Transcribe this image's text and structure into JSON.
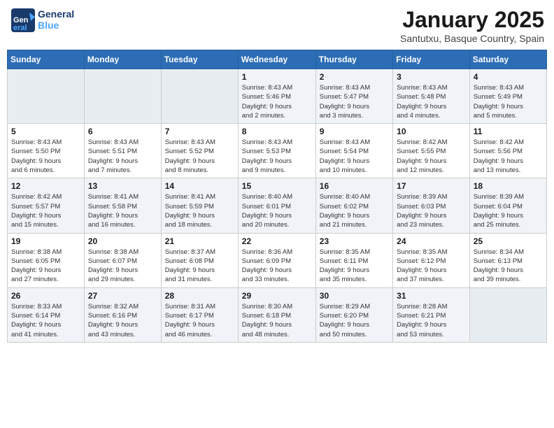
{
  "header": {
    "logo_text_general": "General",
    "logo_text_blue": "Blue",
    "month_title": "January 2025",
    "subtitle": "Santutxu, Basque Country, Spain"
  },
  "weekdays": [
    "Sunday",
    "Monday",
    "Tuesday",
    "Wednesday",
    "Thursday",
    "Friday",
    "Saturday"
  ],
  "weeks": [
    [
      {
        "day": "",
        "info": ""
      },
      {
        "day": "",
        "info": ""
      },
      {
        "day": "",
        "info": ""
      },
      {
        "day": "1",
        "info": "Sunrise: 8:43 AM\nSunset: 5:46 PM\nDaylight: 9 hours\nand 2 minutes."
      },
      {
        "day": "2",
        "info": "Sunrise: 8:43 AM\nSunset: 5:47 PM\nDaylight: 9 hours\nand 3 minutes."
      },
      {
        "day": "3",
        "info": "Sunrise: 8:43 AM\nSunset: 5:48 PM\nDaylight: 9 hours\nand 4 minutes."
      },
      {
        "day": "4",
        "info": "Sunrise: 8:43 AM\nSunset: 5:49 PM\nDaylight: 9 hours\nand 5 minutes."
      }
    ],
    [
      {
        "day": "5",
        "info": "Sunrise: 8:43 AM\nSunset: 5:50 PM\nDaylight: 9 hours\nand 6 minutes."
      },
      {
        "day": "6",
        "info": "Sunrise: 8:43 AM\nSunset: 5:51 PM\nDaylight: 9 hours\nand 7 minutes."
      },
      {
        "day": "7",
        "info": "Sunrise: 8:43 AM\nSunset: 5:52 PM\nDaylight: 9 hours\nand 8 minutes."
      },
      {
        "day": "8",
        "info": "Sunrise: 8:43 AM\nSunset: 5:53 PM\nDaylight: 9 hours\nand 9 minutes."
      },
      {
        "day": "9",
        "info": "Sunrise: 8:43 AM\nSunset: 5:54 PM\nDaylight: 9 hours\nand 10 minutes."
      },
      {
        "day": "10",
        "info": "Sunrise: 8:42 AM\nSunset: 5:55 PM\nDaylight: 9 hours\nand 12 minutes."
      },
      {
        "day": "11",
        "info": "Sunrise: 8:42 AM\nSunset: 5:56 PM\nDaylight: 9 hours\nand 13 minutes."
      }
    ],
    [
      {
        "day": "12",
        "info": "Sunrise: 8:42 AM\nSunset: 5:57 PM\nDaylight: 9 hours\nand 15 minutes."
      },
      {
        "day": "13",
        "info": "Sunrise: 8:41 AM\nSunset: 5:58 PM\nDaylight: 9 hours\nand 16 minutes."
      },
      {
        "day": "14",
        "info": "Sunrise: 8:41 AM\nSunset: 5:59 PM\nDaylight: 9 hours\nand 18 minutes."
      },
      {
        "day": "15",
        "info": "Sunrise: 8:40 AM\nSunset: 6:01 PM\nDaylight: 9 hours\nand 20 minutes."
      },
      {
        "day": "16",
        "info": "Sunrise: 8:40 AM\nSunset: 6:02 PM\nDaylight: 9 hours\nand 21 minutes."
      },
      {
        "day": "17",
        "info": "Sunrise: 8:39 AM\nSunset: 6:03 PM\nDaylight: 9 hours\nand 23 minutes."
      },
      {
        "day": "18",
        "info": "Sunrise: 8:39 AM\nSunset: 6:04 PM\nDaylight: 9 hours\nand 25 minutes."
      }
    ],
    [
      {
        "day": "19",
        "info": "Sunrise: 8:38 AM\nSunset: 6:05 PM\nDaylight: 9 hours\nand 27 minutes."
      },
      {
        "day": "20",
        "info": "Sunrise: 8:38 AM\nSunset: 6:07 PM\nDaylight: 9 hours\nand 29 minutes."
      },
      {
        "day": "21",
        "info": "Sunrise: 8:37 AM\nSunset: 6:08 PM\nDaylight: 9 hours\nand 31 minutes."
      },
      {
        "day": "22",
        "info": "Sunrise: 8:36 AM\nSunset: 6:09 PM\nDaylight: 9 hours\nand 33 minutes."
      },
      {
        "day": "23",
        "info": "Sunrise: 8:35 AM\nSunset: 6:11 PM\nDaylight: 9 hours\nand 35 minutes."
      },
      {
        "day": "24",
        "info": "Sunrise: 8:35 AM\nSunset: 6:12 PM\nDaylight: 9 hours\nand 37 minutes."
      },
      {
        "day": "25",
        "info": "Sunrise: 8:34 AM\nSunset: 6:13 PM\nDaylight: 9 hours\nand 39 minutes."
      }
    ],
    [
      {
        "day": "26",
        "info": "Sunrise: 8:33 AM\nSunset: 6:14 PM\nDaylight: 9 hours\nand 41 minutes."
      },
      {
        "day": "27",
        "info": "Sunrise: 8:32 AM\nSunset: 6:16 PM\nDaylight: 9 hours\nand 43 minutes."
      },
      {
        "day": "28",
        "info": "Sunrise: 8:31 AM\nSunset: 6:17 PM\nDaylight: 9 hours\nand 46 minutes."
      },
      {
        "day": "29",
        "info": "Sunrise: 8:30 AM\nSunset: 6:18 PM\nDaylight: 9 hours\nand 48 minutes."
      },
      {
        "day": "30",
        "info": "Sunrise: 8:29 AM\nSunset: 6:20 PM\nDaylight: 9 hours\nand 50 minutes."
      },
      {
        "day": "31",
        "info": "Sunrise: 8:28 AM\nSunset: 6:21 PM\nDaylight: 9 hours\nand 53 minutes."
      },
      {
        "day": "",
        "info": ""
      }
    ]
  ]
}
